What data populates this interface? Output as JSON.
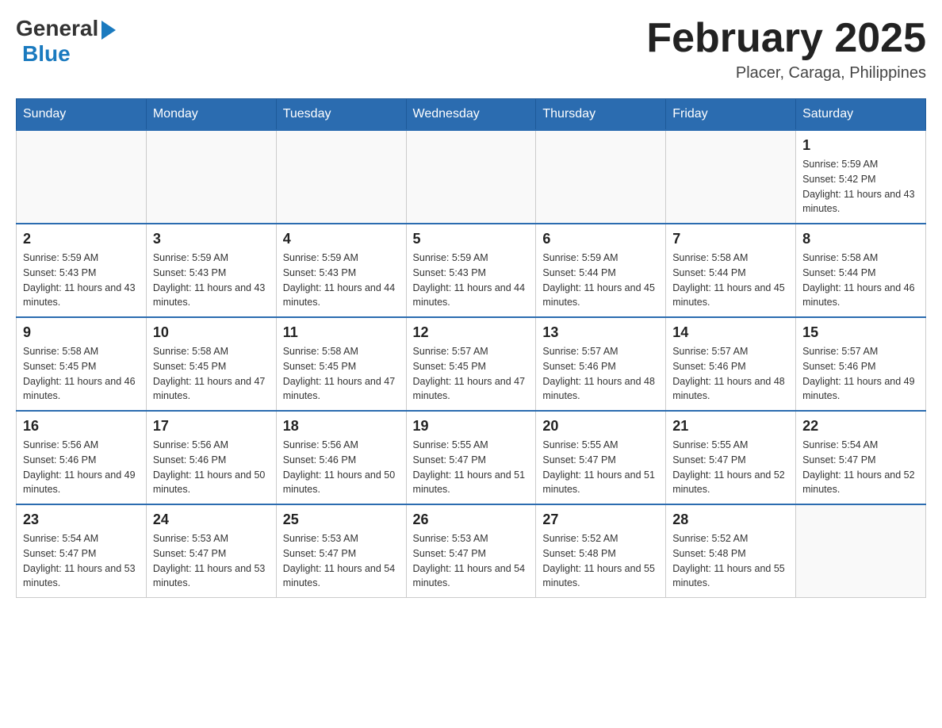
{
  "header": {
    "logo_general": "General",
    "logo_blue": "Blue",
    "main_title": "February 2025",
    "subtitle": "Placer, Caraga, Philippines"
  },
  "calendar": {
    "days_of_week": [
      "Sunday",
      "Monday",
      "Tuesday",
      "Wednesday",
      "Thursday",
      "Friday",
      "Saturday"
    ],
    "weeks": [
      [
        {
          "day": "",
          "info": ""
        },
        {
          "day": "",
          "info": ""
        },
        {
          "day": "",
          "info": ""
        },
        {
          "day": "",
          "info": ""
        },
        {
          "day": "",
          "info": ""
        },
        {
          "day": "",
          "info": ""
        },
        {
          "day": "1",
          "info": "Sunrise: 5:59 AM\nSunset: 5:42 PM\nDaylight: 11 hours and 43 minutes."
        }
      ],
      [
        {
          "day": "2",
          "info": "Sunrise: 5:59 AM\nSunset: 5:43 PM\nDaylight: 11 hours and 43 minutes."
        },
        {
          "day": "3",
          "info": "Sunrise: 5:59 AM\nSunset: 5:43 PM\nDaylight: 11 hours and 43 minutes."
        },
        {
          "day": "4",
          "info": "Sunrise: 5:59 AM\nSunset: 5:43 PM\nDaylight: 11 hours and 44 minutes."
        },
        {
          "day": "5",
          "info": "Sunrise: 5:59 AM\nSunset: 5:43 PM\nDaylight: 11 hours and 44 minutes."
        },
        {
          "day": "6",
          "info": "Sunrise: 5:59 AM\nSunset: 5:44 PM\nDaylight: 11 hours and 45 minutes."
        },
        {
          "day": "7",
          "info": "Sunrise: 5:58 AM\nSunset: 5:44 PM\nDaylight: 11 hours and 45 minutes."
        },
        {
          "day": "8",
          "info": "Sunrise: 5:58 AM\nSunset: 5:44 PM\nDaylight: 11 hours and 46 minutes."
        }
      ],
      [
        {
          "day": "9",
          "info": "Sunrise: 5:58 AM\nSunset: 5:45 PM\nDaylight: 11 hours and 46 minutes."
        },
        {
          "day": "10",
          "info": "Sunrise: 5:58 AM\nSunset: 5:45 PM\nDaylight: 11 hours and 47 minutes."
        },
        {
          "day": "11",
          "info": "Sunrise: 5:58 AM\nSunset: 5:45 PM\nDaylight: 11 hours and 47 minutes."
        },
        {
          "day": "12",
          "info": "Sunrise: 5:57 AM\nSunset: 5:45 PM\nDaylight: 11 hours and 47 minutes."
        },
        {
          "day": "13",
          "info": "Sunrise: 5:57 AM\nSunset: 5:46 PM\nDaylight: 11 hours and 48 minutes."
        },
        {
          "day": "14",
          "info": "Sunrise: 5:57 AM\nSunset: 5:46 PM\nDaylight: 11 hours and 48 minutes."
        },
        {
          "day": "15",
          "info": "Sunrise: 5:57 AM\nSunset: 5:46 PM\nDaylight: 11 hours and 49 minutes."
        }
      ],
      [
        {
          "day": "16",
          "info": "Sunrise: 5:56 AM\nSunset: 5:46 PM\nDaylight: 11 hours and 49 minutes."
        },
        {
          "day": "17",
          "info": "Sunrise: 5:56 AM\nSunset: 5:46 PM\nDaylight: 11 hours and 50 minutes."
        },
        {
          "day": "18",
          "info": "Sunrise: 5:56 AM\nSunset: 5:46 PM\nDaylight: 11 hours and 50 minutes."
        },
        {
          "day": "19",
          "info": "Sunrise: 5:55 AM\nSunset: 5:47 PM\nDaylight: 11 hours and 51 minutes."
        },
        {
          "day": "20",
          "info": "Sunrise: 5:55 AM\nSunset: 5:47 PM\nDaylight: 11 hours and 51 minutes."
        },
        {
          "day": "21",
          "info": "Sunrise: 5:55 AM\nSunset: 5:47 PM\nDaylight: 11 hours and 52 minutes."
        },
        {
          "day": "22",
          "info": "Sunrise: 5:54 AM\nSunset: 5:47 PM\nDaylight: 11 hours and 52 minutes."
        }
      ],
      [
        {
          "day": "23",
          "info": "Sunrise: 5:54 AM\nSunset: 5:47 PM\nDaylight: 11 hours and 53 minutes."
        },
        {
          "day": "24",
          "info": "Sunrise: 5:53 AM\nSunset: 5:47 PM\nDaylight: 11 hours and 53 minutes."
        },
        {
          "day": "25",
          "info": "Sunrise: 5:53 AM\nSunset: 5:47 PM\nDaylight: 11 hours and 54 minutes."
        },
        {
          "day": "26",
          "info": "Sunrise: 5:53 AM\nSunset: 5:47 PM\nDaylight: 11 hours and 54 minutes."
        },
        {
          "day": "27",
          "info": "Sunrise: 5:52 AM\nSunset: 5:48 PM\nDaylight: 11 hours and 55 minutes."
        },
        {
          "day": "28",
          "info": "Sunrise: 5:52 AM\nSunset: 5:48 PM\nDaylight: 11 hours and 55 minutes."
        },
        {
          "day": "",
          "info": ""
        }
      ]
    ]
  }
}
